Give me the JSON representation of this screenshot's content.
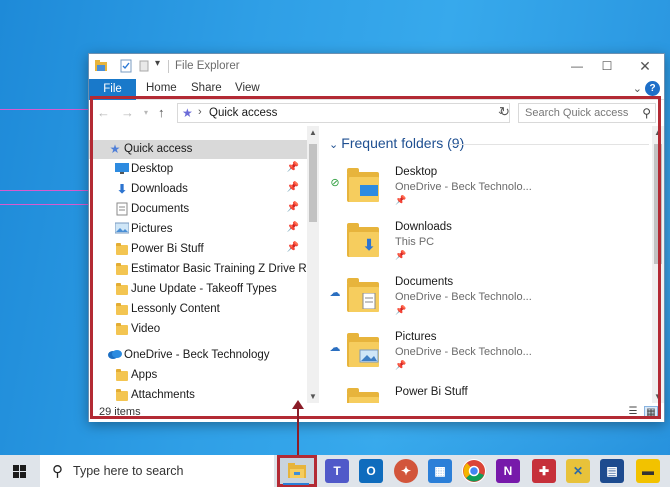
{
  "window": {
    "title": "File Explorer",
    "ribbon_tabs": [
      "File",
      "Home",
      "Share",
      "View"
    ],
    "help_label": "?"
  },
  "address": {
    "path": "Quick access",
    "search_placeholder": "Search Quick access"
  },
  "nav": {
    "items": [
      {
        "label": "Quick access",
        "icon": "star-icon",
        "pinned": false
      },
      {
        "label": "Desktop",
        "icon": "desktop-icon",
        "pinned": true
      },
      {
        "label": "Downloads",
        "icon": "download-icon",
        "pinned": true
      },
      {
        "label": "Documents",
        "icon": "documents-icon",
        "pinned": true
      },
      {
        "label": "Pictures",
        "icon": "pictures-icon",
        "pinned": true
      },
      {
        "label": "Power Bi Stuff",
        "icon": "folder-icon",
        "pinned": true
      },
      {
        "label": "Estimator Basic Training Z Drive Revision",
        "icon": "folder-icon",
        "pinned": false
      },
      {
        "label": "June Update - Takeoff Types",
        "icon": "folder-icon",
        "pinned": false
      },
      {
        "label": "Lessonly Content",
        "icon": "folder-icon",
        "pinned": false
      },
      {
        "label": "Video",
        "icon": "folder-icon",
        "pinned": false
      },
      {
        "label": "OneDrive - Beck Technology",
        "icon": "onedrive-icon",
        "pinned": false
      },
      {
        "label": "Apps",
        "icon": "folder-icon",
        "pinned": false
      },
      {
        "label": "Attachments",
        "icon": "folder-icon",
        "pinned": false
      }
    ]
  },
  "content": {
    "group_header": "Frequent folders (9)",
    "items": [
      {
        "name": "Desktop",
        "location": "OneDrive - Beck Technolo...",
        "status": "synced-check-icon"
      },
      {
        "name": "Downloads",
        "location": "This PC",
        "status": ""
      },
      {
        "name": "Documents",
        "location": "OneDrive - Beck Technolo...",
        "status": "cloud-icon"
      },
      {
        "name": "Pictures",
        "location": "OneDrive - Beck Technolo...",
        "status": "cloud-icon"
      },
      {
        "name": "Power Bi Stuff",
        "location": "",
        "status": ""
      }
    ]
  },
  "statusbar": {
    "item_count": "29 items"
  },
  "taskbar": {
    "search_placeholder": "Type here to search"
  },
  "colors": {
    "accent": "#1979ca",
    "highlight": "#b32a34"
  }
}
